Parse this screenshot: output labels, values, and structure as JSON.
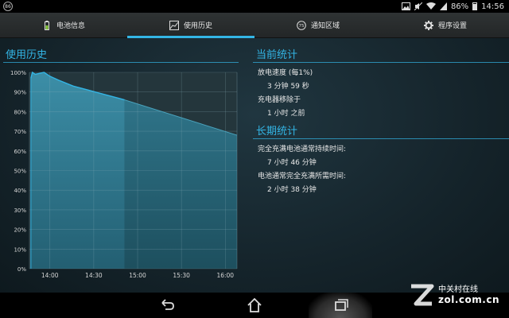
{
  "status_bar": {
    "left_badge": "86",
    "battery_percent": "86%",
    "time": "14:56"
  },
  "tabs": [
    {
      "label": "电池信息",
      "icon": "battery-icon",
      "active": false
    },
    {
      "label": "使用历史",
      "icon": "history-chart-icon",
      "active": true
    },
    {
      "label": "通知区域",
      "icon": "notification-75-icon",
      "icon_text": "75",
      "active": false
    },
    {
      "label": "程序设置",
      "icon": "gear-icon",
      "active": false
    }
  ],
  "usage": {
    "title": "使用历史"
  },
  "current": {
    "title": "当前统计",
    "discharge_label": "放电速度 (每1%)",
    "discharge_value": "3 分钟 59 秒",
    "unplug_label": "充电器移除于",
    "unplug_value": "1 小时 之前"
  },
  "longterm": {
    "title": "长期统计",
    "full_label": "完全充满电池通常持续时间:",
    "full_value": "7 小时 46 分钟",
    "charge_label": "电池通常完全充满所需时间:",
    "charge_value": "2 小时 38 分钟"
  },
  "watermark": {
    "cn": "中关村在线",
    "en": "zol.com.cn"
  },
  "colors": {
    "accent": "#33b5e5"
  },
  "chart_data": {
    "type": "area",
    "title": "",
    "xlabel": "",
    "ylabel": "",
    "x_ticks": [
      "14:00",
      "14:30",
      "15:00",
      "15:30",
      "16:00"
    ],
    "y_ticks": [
      "100%",
      "90%",
      "80%",
      "70%",
      "60%",
      "50%",
      "40%",
      "30%",
      "20%",
      "10%",
      "0%"
    ],
    "ylim": [
      0,
      100
    ],
    "xlim": [
      "13:46",
      "16:08"
    ],
    "grid": true,
    "series": [
      {
        "kind": "history",
        "x": [
          "13:47",
          "13:48",
          "13:50",
          "13:56",
          "14:00",
          "14:06",
          "14:16",
          "14:26",
          "14:36",
          "14:46",
          "14:51"
        ],
        "values": [
          97,
          100,
          99,
          100,
          98,
          96,
          93,
          91,
          89,
          87,
          86
        ]
      },
      {
        "kind": "projection",
        "x": [
          "14:51",
          "16:08"
        ],
        "values": [
          86,
          68
        ]
      }
    ]
  }
}
